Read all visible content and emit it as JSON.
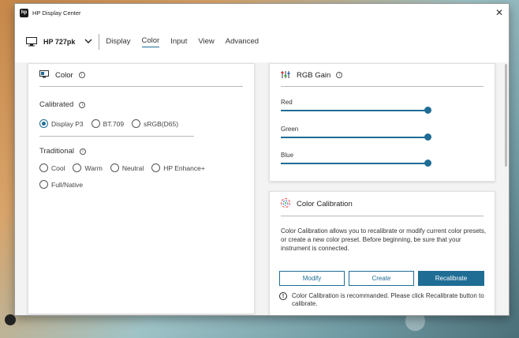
{
  "window": {
    "title": "HP Display Center",
    "close_glyph": "✕",
    "logo_text": "hp"
  },
  "nav": {
    "device": "HP 727pk",
    "chevron": "⌄",
    "tabs": [
      "Display",
      "Color",
      "Input",
      "View",
      "Advanced"
    ],
    "active_tab": "Color"
  },
  "color_panel": {
    "title": "Color",
    "calibrated": {
      "title": "Calibrated",
      "options": [
        "Display P3",
        "BT.709",
        "sRGB(D65)"
      ],
      "selected": "Display P3"
    },
    "traditional": {
      "title": "Traditional",
      "options": [
        "Cool",
        "Warm",
        "Neutral",
        "HP Enhance+",
        "Full/Native"
      ]
    }
  },
  "rgb_panel": {
    "title": "RGB Gain",
    "sliders": [
      {
        "label": "Red",
        "value": 1.0
      },
      {
        "label": "Green",
        "value": 1.0
      },
      {
        "label": "Blue",
        "value": 1.0
      }
    ]
  },
  "calib_panel": {
    "title": "Color Calibration",
    "description": "Color Calibration allows you to recalibrate or modify current color presets, or create a new color preset. Before beginning, be sure that your instrument is connected.",
    "buttons": {
      "modify": "Modify",
      "create": "Create",
      "recalibrate": "Recalibrate"
    },
    "warning": "Color Calibration is recommanded. Please click Recalibrate button to calibrate."
  },
  "colors": {
    "accent": "#1f6d95"
  },
  "icons": {
    "info": "i",
    "warning": "!"
  }
}
